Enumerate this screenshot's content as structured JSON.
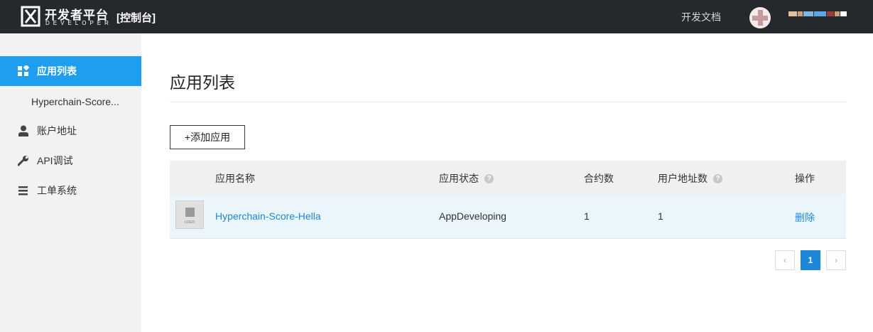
{
  "header": {
    "logo_title": "开发者平台",
    "logo_subtitle": "DEVELOPER",
    "console_label": "[控制台]",
    "docs_link": "开发文档",
    "username_colors": [
      "#e0c0a0",
      "#c9a07a",
      "#7ab8e0",
      "#5aa6e6",
      "#9a3c3c",
      "#c9a07a",
      "#ffffff"
    ]
  },
  "sidebar": {
    "items": [
      {
        "label": "应用列表",
        "icon": "grid-icon",
        "active": true
      },
      {
        "label": "账户地址",
        "icon": "user-icon",
        "active": false
      },
      {
        "label": "API调试",
        "icon": "wrench-icon",
        "active": false
      },
      {
        "label": "工单系统",
        "icon": "list-icon",
        "active": false
      }
    ],
    "sub_item": "Hyperchain-Score..."
  },
  "main": {
    "title": "应用列表",
    "add_button": "+添加应用",
    "table": {
      "columns": [
        "应用名称",
        "应用状态",
        "合约数",
        "用户地址数",
        "操作"
      ],
      "help_glyph": "?",
      "rows": [
        {
          "logo_text": "LOGO",
          "name": "Hyperchain-Score-Hella",
          "status": "AppDeveloping",
          "contracts": "1",
          "addresses": "1",
          "action": "删除"
        }
      ]
    },
    "pagination": {
      "prev": "‹",
      "current": "1",
      "next": "›"
    }
  },
  "colors": {
    "topbar": "#25282c",
    "accent": "#1e9eef",
    "link": "#1e88d8",
    "sidebar": "#f2f2f2"
  }
}
